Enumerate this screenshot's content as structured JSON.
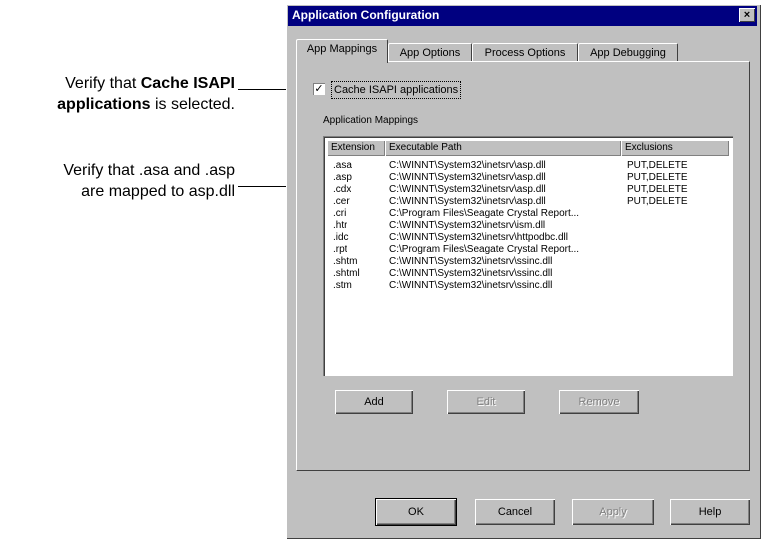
{
  "callouts": {
    "c1_pre": "Verify that ",
    "c1_bold": "Cache ISAPI",
    "c1_bold2": "applications",
    "c1_post": " is selected.",
    "c2_line1": "Verify that .asa and .asp",
    "c2_line2": "are mapped to asp.dll"
  },
  "window": {
    "title": "Application Configuration",
    "close_glyph": "×"
  },
  "tabs": [
    {
      "label": "App Mappings",
      "active": true
    },
    {
      "label": "App Options",
      "active": false
    },
    {
      "label": "Process Options",
      "active": false
    },
    {
      "label": "App Debugging",
      "active": false
    }
  ],
  "cache_isapi": {
    "label": "Cache ISAPI applications",
    "checked_glyph": "✓"
  },
  "mappings": {
    "group_label": "Application Mappings",
    "columns": [
      "Extension",
      "Executable Path",
      "Exclusions"
    ],
    "rows": [
      {
        "ext": ".asa",
        "path": "C:\\WINNT\\System32\\inetsrv\\asp.dll",
        "excl": "PUT,DELETE"
      },
      {
        "ext": ".asp",
        "path": "C:\\WINNT\\System32\\inetsrv\\asp.dll",
        "excl": "PUT,DELETE"
      },
      {
        "ext": ".cdx",
        "path": "C:\\WINNT\\System32\\inetsrv\\asp.dll",
        "excl": "PUT,DELETE"
      },
      {
        "ext": ".cer",
        "path": "C:\\WINNT\\System32\\inetsrv\\asp.dll",
        "excl": "PUT,DELETE"
      },
      {
        "ext": ".cri",
        "path": "C:\\Program Files\\Seagate Crystal Report...",
        "excl": ""
      },
      {
        "ext": ".htr",
        "path": "C:\\WINNT\\System32\\inetsrv\\ism.dll",
        "excl": ""
      },
      {
        "ext": ".idc",
        "path": "C:\\WINNT\\System32\\inetsrv\\httpodbc.dll",
        "excl": ""
      },
      {
        "ext": ".rpt",
        "path": "C:\\Program Files\\Seagate Crystal Report...",
        "excl": ""
      },
      {
        "ext": ".shtm",
        "path": "C:\\WINNT\\System32\\inetsrv\\ssinc.dll",
        "excl": ""
      },
      {
        "ext": ".shtml",
        "path": "C:\\WINNT\\System32\\inetsrv\\ssinc.dll",
        "excl": ""
      },
      {
        "ext": ".stm",
        "path": "C:\\WINNT\\System32\\inetsrv\\ssinc.dll",
        "excl": ""
      }
    ]
  },
  "mapping_buttons": {
    "add": "Add",
    "edit": "Edit",
    "remove": "Remove"
  },
  "footer_buttons": {
    "ok": "OK",
    "cancel": "Cancel",
    "apply": "Apply",
    "help": "Help"
  }
}
